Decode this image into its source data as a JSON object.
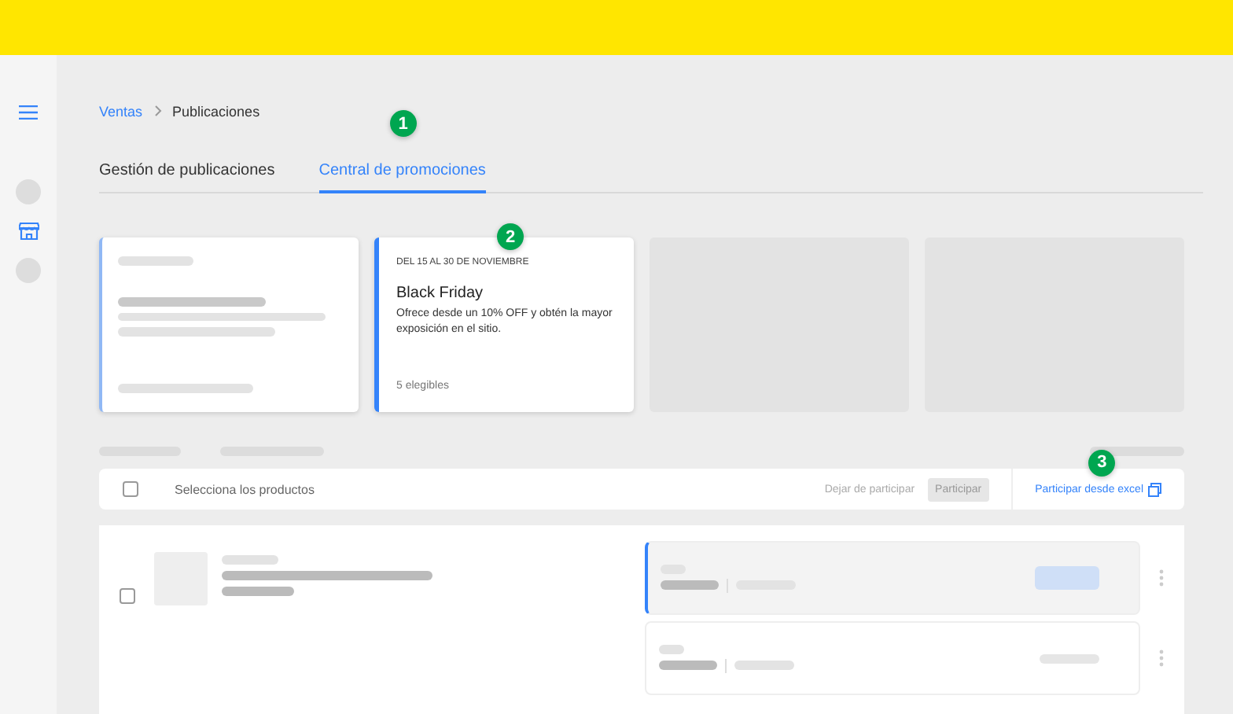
{
  "breadcrumb": [
    {
      "label": "Ventas",
      "link": true
    },
    {
      "label": "Publicaciones",
      "link": false
    }
  ],
  "tabs": [
    {
      "label": "Gestión de publicaciones",
      "selected": false
    },
    {
      "label": "Central de promociones",
      "selected": true,
      "step": "1"
    }
  ],
  "cards": [
    {
      "kind": "skeleton"
    },
    {
      "kind": "promo",
      "selected": true,
      "step": "2",
      "date": "DEL 15 AL 30 DE NOVIEMBRE",
      "title": "Black Friday",
      "description": "Ofrece desde un 10% OFF y obtén la mayor exposición en el sitio.",
      "count": "5 elegibles"
    },
    {
      "kind": "empty"
    },
    {
      "kind": "empty"
    }
  ],
  "toolbar": {
    "checked": false,
    "label": "Selecciona los productos",
    "secondary": "Dejar de participar",
    "primary": {
      "label": "Participar",
      "disabled": true
    },
    "excel": {
      "label": "Participar desde excel",
      "step": "3"
    }
  },
  "product": {
    "checked": false,
    "offers": [
      {
        "selected": true
      },
      {
        "selected": false
      }
    ]
  }
}
